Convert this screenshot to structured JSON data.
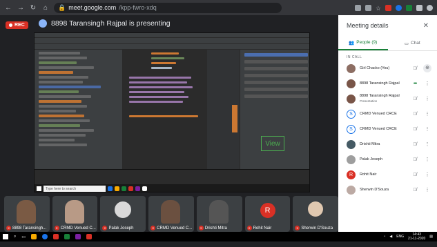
{
  "browser": {
    "url_host": "meet.google.com",
    "url_path": "/kpp-fwro-xdq",
    "colors": {
      "bar": "#35363a",
      "url_box": "#202124"
    }
  },
  "meeting": {
    "rec_label": "REC",
    "presenter_text": "8898 Taransingh Rajpal is presenting",
    "shared_screen": {
      "view_label": "View",
      "taskbar_search": "Type here to search"
    },
    "tiles": [
      {
        "label": "8898 Taransingh...",
        "photo_color": "#7a5a44"
      },
      {
        "label": "CRMD Venued C...",
        "photo_color": "#b89a86"
      },
      {
        "label": "Palak Joseph",
        "photo_color": "#d9d9d9"
      },
      {
        "label": "CRMD Venued C...",
        "photo_color": "#6b5040"
      },
      {
        "label": "Drishti Mitra",
        "photo_color": "#555"
      },
      {
        "label": "Rohit Nair",
        "letter": "R"
      },
      {
        "label": "Sherwin D'Souza",
        "photo_color": "#e0c8b0"
      }
    ]
  },
  "side_panel": {
    "title": "Meeting details",
    "close_icon": "close-icon",
    "tabs": [
      {
        "label": "People (9)",
        "icon": "people-icon",
        "active": true
      },
      {
        "label": "Chat",
        "icon": "chat-icon",
        "active": false
      }
    ],
    "section_label": "IN CALL",
    "people": [
      {
        "name": "Girl Chacko (You)",
        "sub": "",
        "avatar_color": "#8d6e63",
        "action1": "mic-off-icon",
        "action2": "pin-icon"
      },
      {
        "name": "8898 Taransingh Rajpal",
        "sub": "",
        "avatar_color": "#795548",
        "action1": "speaking-icon",
        "action2": "more-icon"
      },
      {
        "name": "8898 Taransingh Rajpal",
        "sub": "Presentation",
        "avatar_color": "#795548",
        "action1": "mic-off-icon",
        "action2": "more-icon"
      },
      {
        "name": "CRMD Venued CRCE",
        "sub": "",
        "avatar_color": "#1a73e8",
        "action1": "mic-off-icon",
        "action2": "more-icon"
      },
      {
        "name": "CRMD Venued CRCE",
        "sub": "",
        "avatar_color": "#1a73e8",
        "action1": "mic-off-icon",
        "action2": "more-icon"
      },
      {
        "name": "Drishti Mitra",
        "sub": "",
        "avatar_color": "#455a64",
        "action1": "mic-off-icon",
        "action2": "more-icon"
      },
      {
        "name": "Palak Joseph",
        "sub": "",
        "avatar_color": "#9e9e9e",
        "action1": "mic-off-icon",
        "action2": "more-icon"
      },
      {
        "name": "Rohit Nair",
        "sub": "",
        "avatar_color": "#d93025",
        "letter": "R",
        "action1": "mic-off-icon",
        "action2": "more-icon"
      },
      {
        "name": "Sherwin D'Souza",
        "sub": "",
        "avatar_color": "#bcaaa4",
        "action1": "mic-off-icon",
        "action2": "more-icon"
      }
    ]
  },
  "os_taskbar": {
    "lang": "ENG",
    "time": "14:43",
    "date": "21-11-2020"
  },
  "accent": {
    "green": "#188038",
    "red": "#d93025"
  }
}
